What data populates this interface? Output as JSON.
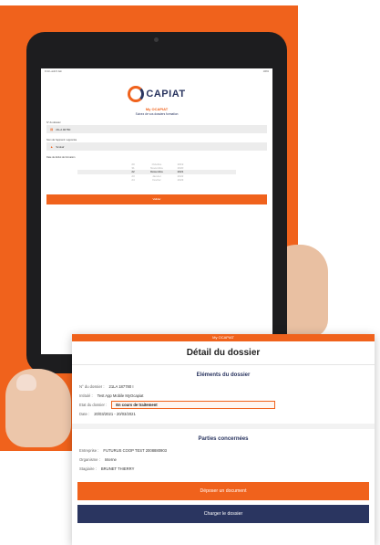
{
  "brand": {
    "logo_text": "CAPIAT",
    "orange": "#f0621c",
    "navy": "#2a3560"
  },
  "tablet_screen": {
    "status_left": "9:41 Lundi 8 Juin",
    "status_right": "100%",
    "app_name": "My OCAPIAT",
    "app_subtitle": "Suivez de vos dossiers formation",
    "company_label": "N° du dossier",
    "company_value": "21LA 90780",
    "dossier_label": "Nom de l'apprenti / apprentie",
    "dossier_value": "Scolair",
    "date_label": "Date de début de formation",
    "picker_rows": [
      [
        "20",
        "Octobre",
        "2019"
      ],
      [
        "31",
        "Novembre",
        "2020"
      ],
      [
        "22",
        "Décembre",
        "2021"
      ],
      [
        "23",
        "Janvier",
        "2022"
      ],
      [
        "24",
        "Février",
        "2023"
      ]
    ],
    "picker_selected": [
      "22",
      "Décembre",
      "2021"
    ],
    "submit_label": "Valider"
  },
  "detail": {
    "top_label": "My OCAPIAT",
    "title": "Détail du dossier",
    "section1_title": "Eléments du dossier",
    "rows1": [
      {
        "label": "N° du dossier :",
        "value": "21LA 187780 I"
      },
      {
        "label": "Intitulé :",
        "value": "Test App Mobile MyOcapiat"
      },
      {
        "label": "Etat du dossier :",
        "value": "En cours de traitement"
      },
      {
        "label": "Date :",
        "value": "20/03/2021 - 20/03/2021"
      }
    ],
    "section2_title": "Parties concernées",
    "rows2": [
      {
        "label": "Entreprise :",
        "value": "FUTURUS COOP TEST 2008880903"
      },
      {
        "label": "Organisme :",
        "value": "Interne"
      },
      {
        "label": "Stagiaire :",
        "value": "BRUNET THIERRY"
      }
    ],
    "btn_upload": "Déposer un document",
    "btn_download": "Charger le dossier"
  }
}
